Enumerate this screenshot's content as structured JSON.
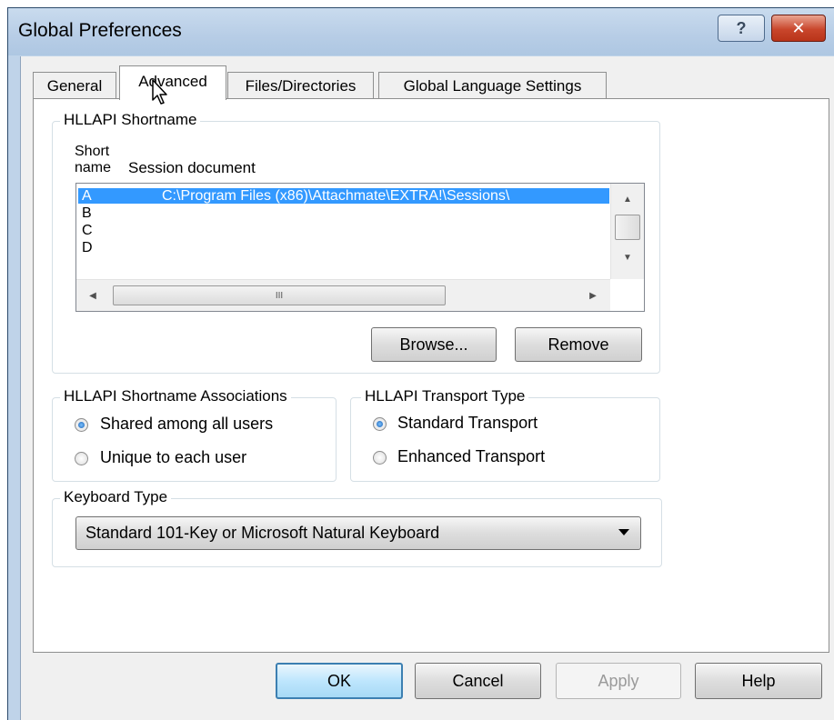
{
  "window": {
    "title": "Global Preferences",
    "help_glyph": "?",
    "close_glyph": "✕"
  },
  "tabs": [
    {
      "label": "General",
      "selected": false
    },
    {
      "label": "Advanced",
      "selected": true
    },
    {
      "label": "Files/Directories",
      "selected": false
    },
    {
      "label": "Global Language Settings",
      "selected": false
    }
  ],
  "hllapi_shortname": {
    "legend": "HLLAPI Shortname",
    "col_short_line1": "Short",
    "col_short_line2": "name",
    "col_doc": "Session document",
    "rows": [
      {
        "short": "A",
        "doc": "C:\\Program Files (x86)\\Attachmate\\EXTRA!\\Sessions\\",
        "selected": true
      },
      {
        "short": "B",
        "doc": ""
      },
      {
        "short": "C",
        "doc": ""
      },
      {
        "short": "D",
        "doc": ""
      }
    ],
    "hscroll_grip": "III",
    "browse_label": "Browse...",
    "remove_label": "Remove"
  },
  "associations": {
    "legend": "HLLAPI Shortname Associations",
    "options": [
      {
        "label": "Shared among all users",
        "checked": true
      },
      {
        "label": "Unique to each user",
        "checked": false
      }
    ]
  },
  "transport": {
    "legend": "HLLAPI Transport Type",
    "options": [
      {
        "label": "Standard Transport",
        "checked": true
      },
      {
        "label": "Enhanced Transport",
        "checked": false
      }
    ]
  },
  "keyboard": {
    "legend": "Keyboard Type",
    "selected": "Standard 101-Key or Microsoft Natural Keyboard"
  },
  "footer": {
    "ok_label": "OK",
    "cancel_label": "Cancel",
    "apply_label": "Apply",
    "help_label": "Help"
  },
  "colors": {
    "selection": "#3399ff",
    "title_bar": "#bfd3e9",
    "close_button": "#c9462c"
  }
}
